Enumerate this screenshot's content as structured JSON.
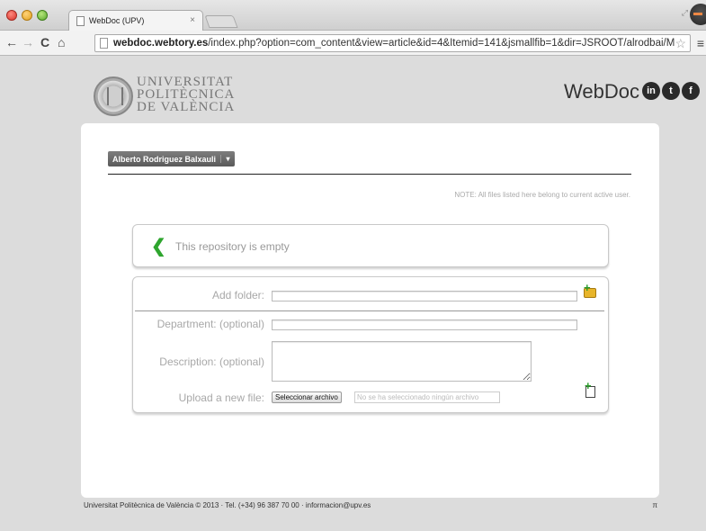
{
  "browser": {
    "tab_title": "WebDoc (UPV)",
    "tab_close": "×",
    "url_host": "webdoc.webtory.es",
    "url_path": "/index.php?option=com_content&view=article&id=4&Itemid=141&jsmallfib=1&dir=JSROOT/alrodbai/Mi...",
    "back": "←",
    "forward": "→",
    "reload": "C",
    "home": "⌂",
    "star": "☆",
    "menu": "≡"
  },
  "header": {
    "university_lines": [
      "UNIVERSITAT",
      "POLITÈCNICA",
      "DE VALÈNCIA"
    ],
    "brand": "WebDoc",
    "social": {
      "linkedin": "in",
      "tumblr": "t",
      "facebook": "f"
    }
  },
  "user": {
    "name": "Alberto Rodriguez Balxauli",
    "caret": "▾"
  },
  "note": "NOTE: All files listed here belong to current active user.",
  "repository": {
    "empty_message": "This repository is empty",
    "back_glyph": "❮"
  },
  "form": {
    "add_folder_label": "Add folder:",
    "add_folder_value": "",
    "department_label": "Department: (optional)",
    "department_value": "",
    "description_label": "Description: (optional)",
    "description_value": "",
    "upload_label": "Upload a new file:",
    "file_button": "Seleccionar archivo",
    "file_none": "No se ha seleccionado ningún archivo"
  },
  "footer": {
    "text": "Universitat Politècnica de València © 2013 · Tel. (+34) 96 387 70 00 · informacion@upv.es",
    "symbol": "π"
  },
  "colors": {
    "accent_green": "#2ea52e",
    "folder_yellow": "#e8b52a"
  }
}
